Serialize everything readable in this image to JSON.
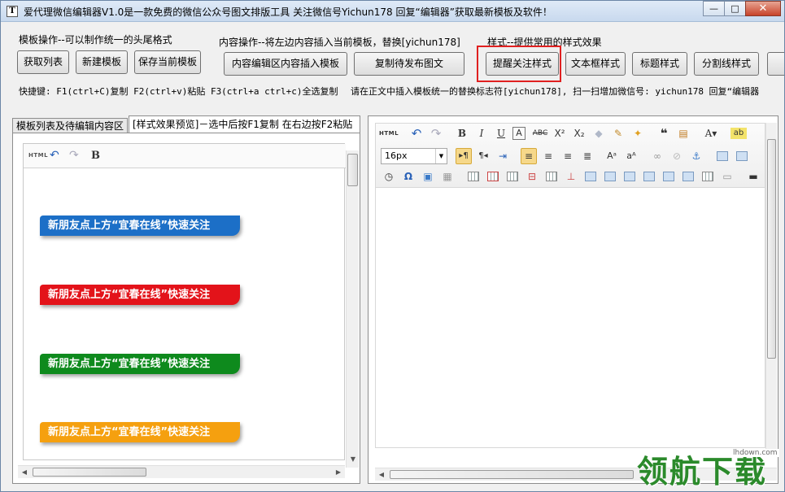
{
  "window": {
    "title": "爱代理微信编辑器V1.0是一款免费的微信公众号图文排版工具 关注微信号Yichun178 回复“编辑器”获取最新模板及软件！",
    "icon_letter": "T",
    "controls": {
      "minimize": "—",
      "maximize": "□",
      "close": "✕"
    }
  },
  "groups": {
    "template": {
      "label": "模板操作--可以制作统一的头尾格式",
      "buttons": [
        "获取列表",
        "新建模板",
        "保存当前模板"
      ]
    },
    "content": {
      "label": "内容操作--将左边内容插入当前模板，替换[yichun178]",
      "buttons": [
        "内容编辑区内容插入模板",
        "复制待发布图文"
      ]
    },
    "style": {
      "label": "样式--提供常用的样式效果",
      "buttons": [
        "提醒关注样式",
        "文本框样式",
        "标题样式",
        "分割线样式"
      ]
    }
  },
  "info": {
    "shortcuts": "快捷键: F1(ctrl+C)复制  F2(ctrl+v)粘贴 F3(ctrl+a ctrl+c)全选复制",
    "hint": "请在正文中插入模板统一的替换标志符[yichun178],  扫一扫增加微信号: yichun178 回复“编辑器"
  },
  "tabs": [
    "模板列表及待编辑内容区",
    "[样式效果预览]－选中后按F1复制 在右边按F2粘贴"
  ],
  "preview": {
    "banners": [
      {
        "text": "新朋友点上方“宜春在线”快速关注",
        "color": "#1c6fc7"
      },
      {
        "text": "新朋友点上方“宜春在线”快速关注",
        "color": "#e3131a"
      },
      {
        "text": "新朋友点上方“宜春在线”快速关注",
        "color": "#0e8a1d"
      },
      {
        "text": "新朋友点上方“宜春在线”快速关注",
        "color": "#f5a00f"
      }
    ],
    "mini_toolbar": [
      "html-icon",
      "undo-icon",
      "redo-icon",
      "bold-icon"
    ]
  },
  "editor": {
    "font_size": "16px",
    "html_label": "HTML"
  },
  "watermark": {
    "text": "领航下载",
    "url": "lhdown.com"
  }
}
